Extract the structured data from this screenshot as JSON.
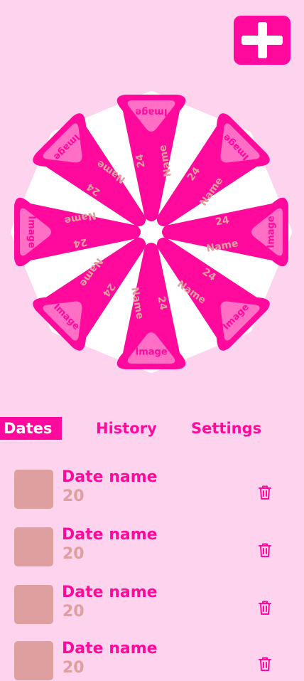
{
  "colors": {
    "background": "#fdd3ee",
    "accent": "#ff0a9c",
    "slice_inner": "#ff6fc6",
    "muted": "#de9f9f",
    "wheel_backing": "#ffffff"
  },
  "header": {
    "add_icon": "plus-icon"
  },
  "wheel": {
    "slices": [
      {
        "image_label": "Image",
        "name_label": "Name",
        "number_label": "24"
      },
      {
        "image_label": "Image",
        "name_label": "Name",
        "number_label": "24"
      },
      {
        "image_label": "Image",
        "name_label": "Name",
        "number_label": "24"
      },
      {
        "image_label": "Image",
        "name_label": "Name",
        "number_label": "24"
      },
      {
        "image_label": "Image",
        "name_label": "Name",
        "number_label": "24"
      },
      {
        "image_label": "Image",
        "name_label": "Name",
        "number_label": "24"
      },
      {
        "image_label": "Image",
        "name_label": "Name",
        "number_label": "24"
      },
      {
        "image_label": "Image",
        "name_label": "Name",
        "number_label": "24"
      }
    ]
  },
  "tabs": [
    {
      "label": "Dates",
      "active": true
    },
    {
      "label": "History",
      "active": false
    },
    {
      "label": "Settings",
      "active": false
    }
  ],
  "dates": [
    {
      "name": "Date name",
      "value": "20",
      "delete_icon": "trash-icon"
    },
    {
      "name": "Date name",
      "value": "20",
      "delete_icon": "trash-icon"
    },
    {
      "name": "Date name",
      "value": "20",
      "delete_icon": "trash-icon"
    },
    {
      "name": "Date name",
      "value": "20",
      "delete_icon": "trash-icon"
    }
  ]
}
